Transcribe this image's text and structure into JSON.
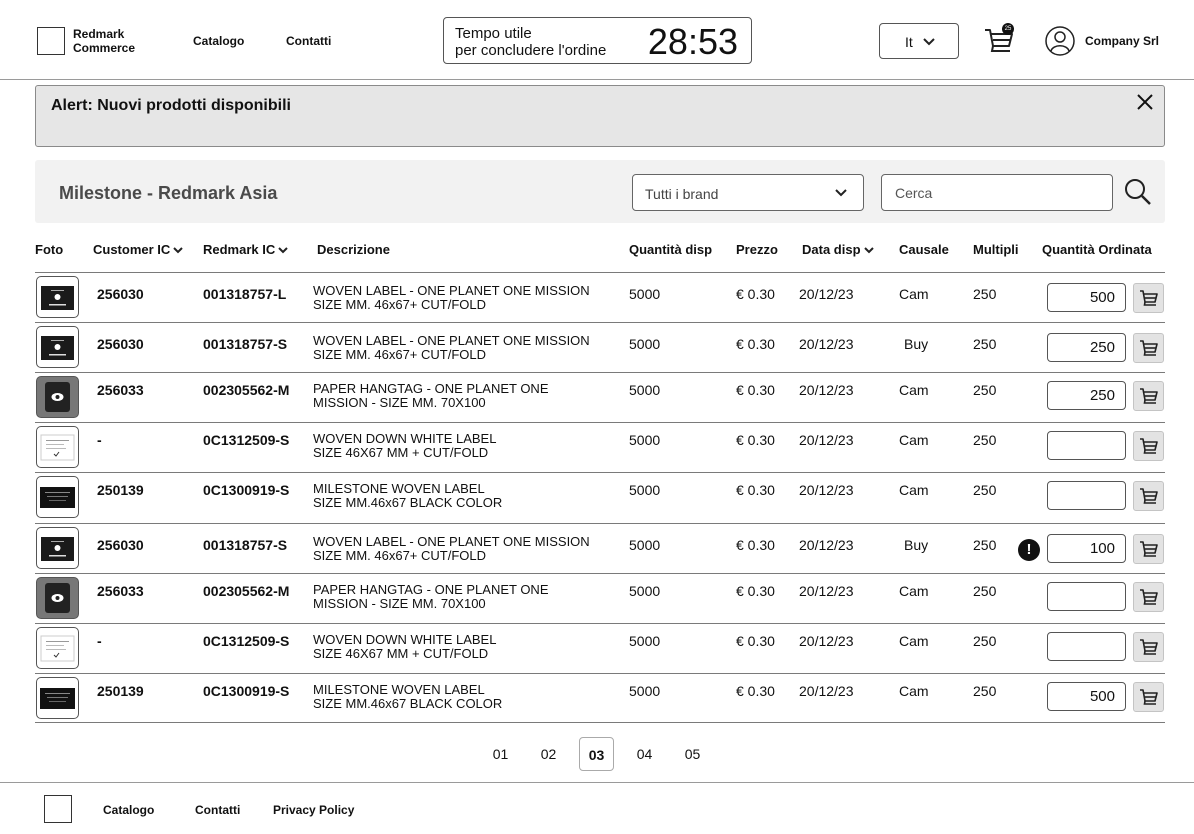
{
  "header": {
    "brand_line1": "Redmark",
    "brand_line2": "Commerce",
    "nav": [
      "Catalogo",
      "Contatti"
    ],
    "timer_label_line1": "Tempo utile",
    "timer_label_line2": "per concludere l'ordine",
    "timer_value": "28:53",
    "language": "It",
    "cart_count": "25",
    "company": "Company Srl"
  },
  "alert": {
    "text": "Alert: Nuovi prodotti disponibili"
  },
  "filters": {
    "title": "Milestone - Redmark Asia",
    "brand_select": "Tutti i brand",
    "search_placeholder": "Cerca"
  },
  "table": {
    "columns": {
      "foto": "Foto",
      "customer_ic": "Customer IC",
      "redmark_ic": "Redmark IC",
      "descrizione": "Descrizione",
      "quantita_disp": "Quantità disp",
      "prezzo": "Prezzo",
      "data_disp": "Data disp",
      "causale": "Causale",
      "multipli": "Multipli",
      "quantita_ordinata": "Quantità Ordinata"
    },
    "rows": [
      {
        "thumb": "label-black",
        "customer_ic": "256030",
        "redmark_ic": "001318757-L",
        "desc1": "WOVEN LABEL - ONE PLANET ONE MISSION",
        "desc2": "SIZE  MM. 46x67+ CUT/FOLD",
        "qty": "5000",
        "price": "€ 0.30",
        "date": "20/12/23",
        "causale": "Cam",
        "multipli": "250",
        "ordered": "500",
        "warning": false
      },
      {
        "thumb": "label-black",
        "customer_ic": "256030",
        "redmark_ic": "001318757-S",
        "desc1": "WOVEN LABEL - ONE PLANET ONE MISSION",
        "desc2": "SIZE  MM. 46x67+ CUT/FOLD",
        "qty": "5000",
        "price": "€ 0.30",
        "date": "20/12/23",
        "causale": "Buy",
        "multipli": "250",
        "ordered": "250",
        "warning": false
      },
      {
        "thumb": "hangtag",
        "customer_ic": "256033",
        "redmark_ic": "002305562-M",
        "desc1": "PAPER HANGTAG - ONE PLANET ONE",
        "desc2": "MISSION  -  SIZE  MM. 70X100",
        "qty": "5000",
        "price": "€ 0.30",
        "date": "20/12/23",
        "causale": "Cam",
        "multipli": "250",
        "ordered": "250",
        "warning": false
      },
      {
        "thumb": "label-white",
        "customer_ic": "-",
        "redmark_ic": "0C1312509-S",
        "desc1": "WOVEN DOWN WHITE LABEL",
        "desc2": "SIZE 46X67 MM + CUT/FOLD",
        "qty": "5000",
        "price": "€ 0.30",
        "date": "20/12/23",
        "causale": "Cam",
        "multipli": "250",
        "ordered": "",
        "warning": false
      },
      {
        "thumb": "label-dark",
        "customer_ic": "250139",
        "redmark_ic": "0C1300919-S",
        "desc1": "MILESTONE WOVEN LABEL",
        "desc2": "SIZE MM.46x67 BLACK COLOR",
        "qty": "5000",
        "price": "€ 0.30",
        "date": "20/12/23",
        "causale": "Cam",
        "multipli": "250",
        "ordered": "",
        "warning": false
      },
      {
        "thumb": "label-black",
        "customer_ic": "256030",
        "redmark_ic": "001318757-S",
        "desc1": "WOVEN LABEL - ONE PLANET ONE MISSION",
        "desc2": "SIZE  MM. 46x67+ CUT/FOLD",
        "qty": "5000",
        "price": "€ 0.30",
        "date": "20/12/23",
        "causale": "Buy",
        "multipli": "250",
        "ordered": "100",
        "warning": true
      },
      {
        "thumb": "hangtag",
        "customer_ic": "256033",
        "redmark_ic": "002305562-M",
        "desc1": "PAPER HANGTAG - ONE PLANET ONE",
        "desc2": "MISSION  -  SIZE  MM. 70X100",
        "qty": "5000",
        "price": "€ 0.30",
        "date": "20/12/23",
        "causale": "Cam",
        "multipli": "250",
        "ordered": "",
        "warning": false
      },
      {
        "thumb": "label-white",
        "customer_ic": "-",
        "redmark_ic": "0C1312509-S",
        "desc1": "WOVEN DOWN WHITE LABEL",
        "desc2": "SIZE 46X67 MM + CUT/FOLD",
        "qty": "5000",
        "price": "€ 0.30",
        "date": "20/12/23",
        "causale": "Cam",
        "multipli": "250",
        "ordered": "",
        "warning": false
      },
      {
        "thumb": "label-dark",
        "customer_ic": "250139",
        "redmark_ic": "0C1300919-S",
        "desc1": "MILESTONE WOVEN LABEL",
        "desc2": "SIZE MM.46x67 BLACK COLOR",
        "qty": "5000",
        "price": "€ 0.30",
        "date": "20/12/23",
        "causale": "Cam",
        "multipli": "250",
        "ordered": "500",
        "warning": false
      }
    ]
  },
  "pagination": {
    "pages": [
      "01",
      "02",
      "03",
      "04",
      "05"
    ],
    "current": "03"
  },
  "footer": {
    "links": [
      "Catalogo",
      "Contatti",
      "Privacy Policy"
    ]
  },
  "colors": {
    "alert_bg": "#e6e6e6",
    "filter_bg": "#f2f2f2",
    "cart_btn_bg": "#e3e3e3"
  }
}
